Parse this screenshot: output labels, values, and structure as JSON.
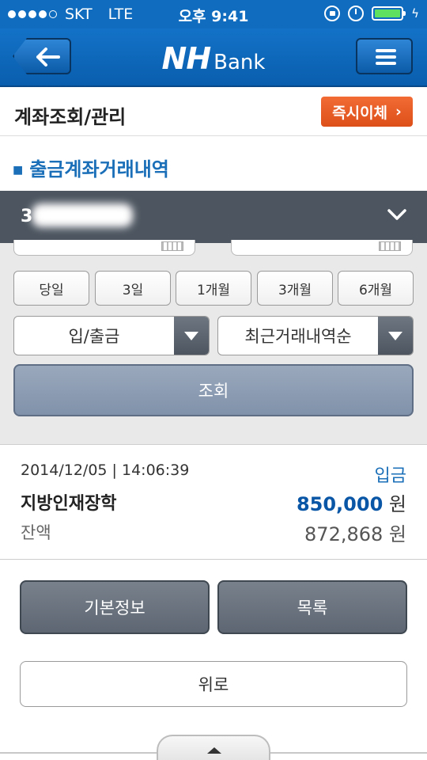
{
  "statusbar": {
    "carrier": "SKT",
    "network": "LTE",
    "time": "오후 9:41"
  },
  "header": {
    "logo_nh": "NH",
    "logo_bank": "Bank"
  },
  "titlebar": {
    "title": "계좌조회/관리",
    "instant_transfer_label": "즉시이체",
    "instant_transfer_chevron": "›"
  },
  "section": {
    "subtitle": "출금계좌거래내역"
  },
  "account": {
    "number_prefix": "3"
  },
  "query": {
    "periods": [
      "당일",
      "3일",
      "1개월",
      "3개월",
      "6개월"
    ],
    "type_select": "입/출금",
    "order_select": "최근거래내역순",
    "search_label": "조회"
  },
  "transaction": {
    "datetime": "2014/12/05 | 14:06:39",
    "type": "입금",
    "description": "지방인재장학",
    "amount": "850,000",
    "amount_unit": "원",
    "balance_label": "잔액",
    "balance": "872,868 원"
  },
  "actions": {
    "basic_info": "기본정보",
    "list": "목록",
    "top": "위로"
  },
  "icons": {
    "back": "back-arrow-icon",
    "menu": "hamburger-menu-icon",
    "expand": "chevron-down-icon",
    "calendar": "calendar-icon",
    "dropdown": "dropdown-arrow-icon",
    "scroll_top": "caret-up-icon"
  },
  "colors": {
    "header_blue": "#0f6cbf",
    "accent_orange": "#e85a22",
    "link_blue": "#1a6fb8",
    "account_bar": "#4d5560",
    "search_button": "#8c9bb2"
  }
}
